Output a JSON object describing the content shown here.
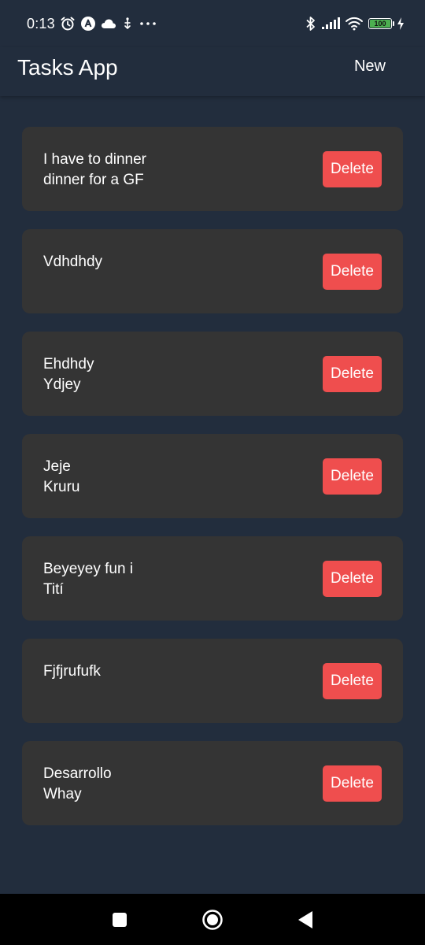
{
  "status_bar": {
    "time": "0:13",
    "battery_level": "100",
    "icons_left": [
      "alarm-icon",
      "app-a-icon",
      "cloud-icon",
      "usb-icon",
      "more-notifications-icon"
    ],
    "icons_right": [
      "bluetooth-icon",
      "signal-icon",
      "wifi-icon",
      "battery-icon",
      "charging-icon"
    ]
  },
  "header": {
    "title": "Tasks App",
    "new_label": "New"
  },
  "tasks": [
    {
      "text": "I have to dinner\ndinner for a GF",
      "delete_label": "Delete"
    },
    {
      "text": "Vdhdhdy",
      "delete_label": "Delete"
    },
    {
      "text": "Ehdhdy\nYdjey",
      "delete_label": "Delete"
    },
    {
      "text": "Jeje\nKruru",
      "delete_label": "Delete"
    },
    {
      "text": "Beyeyey fun i\nTití",
      "delete_label": "Delete"
    },
    {
      "text": "Fjfjrufufk",
      "delete_label": "Delete"
    },
    {
      "text": "Desarrollo\nWhay",
      "delete_label": "Delete"
    }
  ],
  "colors": {
    "background": "#222d3d",
    "card": "#343434",
    "delete": "#ef4e4e",
    "nav_bar": "#000000"
  },
  "nav_bar": {
    "buttons": [
      "recents-icon",
      "home-icon",
      "back-icon"
    ]
  }
}
